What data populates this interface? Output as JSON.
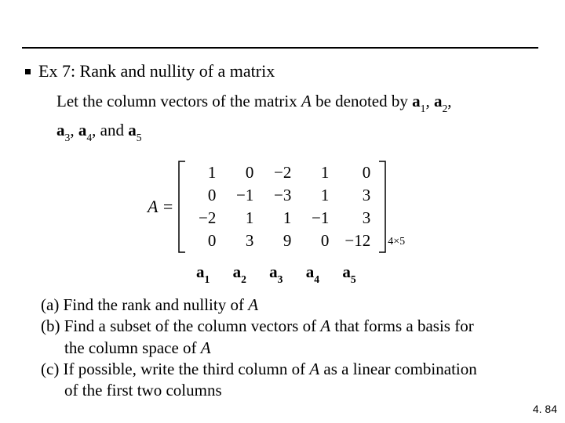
{
  "title": "Ex 7: Rank and nullity of a matrix",
  "intro_pre": "Let the column vectors of the matrix ",
  "intro_A": "A",
  "intro_mid": " be denoted by ",
  "v1": "a",
  "s1": "1",
  "v2": "a",
  "s2": "2",
  "v3": "a",
  "s3": "3",
  "v4": "a",
  "s4": "4",
  "v5": "a",
  "s5": "5",
  "intro_and": ", and ",
  "intro_comma": ", ",
  "matrix_label": "A =",
  "m": {
    "r0c0": "1",
    "r0c1": "0",
    "r0c2": "−2",
    "r0c3": "1",
    "r0c4": "0",
    "r1c0": "0",
    "r1c1": "−1",
    "r1c2": "−3",
    "r1c3": "1",
    "r1c4": "3",
    "r2c0": "−2",
    "r2c1": "1",
    "r2c2": "1",
    "r2c3": "−1",
    "r2c4": "3",
    "r3c0": "0",
    "r3c1": "3",
    "r3c2": "9",
    "r3c3": "0",
    "r3c4": "−12"
  },
  "dims": "4×5",
  "col_labels": {
    "a1": "a",
    "s1": "1",
    "a2": "a",
    "s2": "2",
    "a3": "a",
    "s3": "3",
    "a4": "a",
    "s4": "4",
    "a5": "a",
    "s5": "5"
  },
  "q": {
    "a_pre": "(a) Find the rank and nullity of ",
    "a_A": "A",
    "b_pre": "(b) Find a subset of the column vectors of ",
    "b_A1": "A",
    "b_mid": " that forms a basis for",
    "b_line2_pre": "the column space of  ",
    "b_A2": "A",
    "c_pre": "(c) If possible, write the third column of ",
    "c_A": "A",
    "c_post": " as a linear combination",
    "c_line2": "of the first two columns"
  },
  "page_num": "4. 84"
}
